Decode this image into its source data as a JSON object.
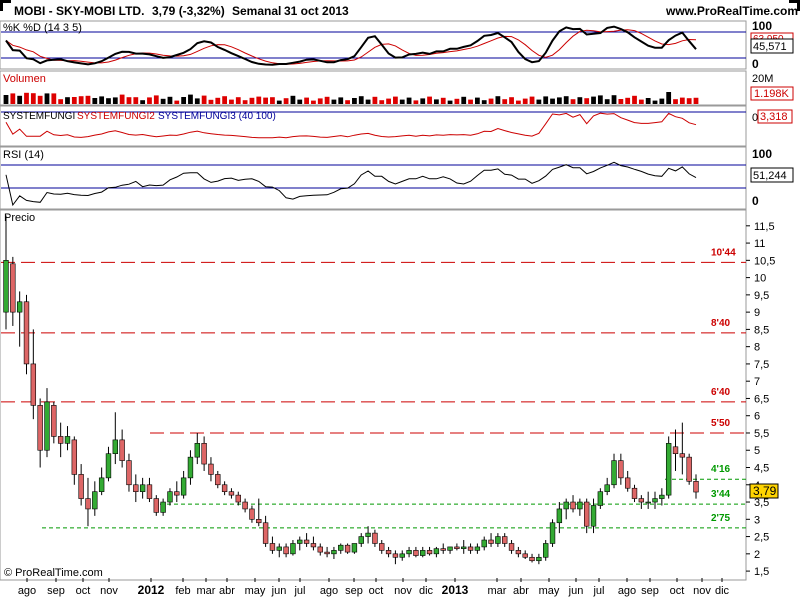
{
  "header": {
    "ticker": "MOBI - SKY-MOBI LTD.",
    "price_change": "3,79 (-3,32%)",
    "period": "Semanal",
    "date": "31 oct 2013",
    "site": "www.ProRealTime.com"
  },
  "footer": {
    "copyright": "© ProRealTime.com"
  },
  "colors": {
    "bull_candle": "#33aa33",
    "bear_candle": "#dd6666",
    "resistance": "#cc0000",
    "support": "#009900",
    "stoch_k": "#000000",
    "stoch_d": "#cc0000",
    "rsi": "#000000",
    "blue_line": "#000099",
    "volume_up": "#000000",
    "volume_down": "#dd0000"
  },
  "panels": {
    "stochastic": {
      "label": "%K %D (14 3 5)",
      "scale_top": "100",
      "scale_bottom": "0",
      "value_d": "63,950",
      "value_k": "45,571"
    },
    "volume": {
      "label": "Volumen",
      "scale_top": "20M",
      "value": "1.198K"
    },
    "systemfungi": {
      "label1": "SYSTEMFUNGI",
      "label2": "SYSTEMFUNGI2",
      "label3": "SYSTEMFUNGI3 (40 100)",
      "value": "3,318",
      "scale_left": "0"
    },
    "rsi": {
      "label": "RSI (14)",
      "scale_top": "100",
      "scale_bottom": "0",
      "value": "51,244"
    },
    "price": {
      "label": "Precio",
      "current_price": "3,79"
    }
  },
  "chart_data": {
    "type": "candlestick",
    "title": "MOBI - SKY-MOBI LTD. Semanal",
    "ylabel": "Precio",
    "ylim": [
      1.3,
      11.9
    ],
    "y_ticks": [
      "1,5",
      "2",
      "2,5",
      "3",
      "3,5",
      "4",
      "4,5",
      "5",
      "5,5",
      "6",
      "6,5",
      "7",
      "7,5",
      "8",
      "8,5",
      "9",
      "9,5",
      "10",
      "10,5",
      "11",
      "11,5"
    ],
    "x_ticks": [
      "ago",
      "sep",
      "oct",
      "nov",
      "2012",
      "feb",
      "mar",
      "abr",
      "may",
      "jun",
      "jul",
      "ago",
      "sep",
      "oct",
      "nov",
      "dic",
      "2013",
      "mar",
      "abr",
      "may",
      "jun",
      "jul",
      "ago",
      "sep",
      "oct",
      "nov",
      "dic"
    ],
    "horizontal_levels": [
      {
        "label": "10'44",
        "value": 10.44,
        "kind": "resistance"
      },
      {
        "label": "8'40",
        "value": 8.4,
        "kind": "resistance"
      },
      {
        "label": "6'40",
        "value": 6.4,
        "kind": "resistance"
      },
      {
        "label": "5'50",
        "value": 5.5,
        "kind": "resistance"
      },
      {
        "label": "4'16",
        "value": 4.16,
        "kind": "support"
      },
      {
        "label": "3'44",
        "value": 3.44,
        "kind": "support"
      },
      {
        "label": "2'75",
        "value": 2.75,
        "kind": "support"
      }
    ],
    "candles": [
      {
        "o": 9.0,
        "h": 11.8,
        "l": 8.5,
        "c": 10.5
      },
      {
        "o": 10.4,
        "h": 10.6,
        "l": 8.6,
        "c": 9.0
      },
      {
        "o": 9.0,
        "h": 9.6,
        "l": 8.0,
        "c": 9.3
      },
      {
        "o": 9.3,
        "h": 9.5,
        "l": 7.2,
        "c": 7.5
      },
      {
        "o": 7.5,
        "h": 8.5,
        "l": 5.9,
        "c": 6.3
      },
      {
        "o": 6.3,
        "h": 6.5,
        "l": 4.5,
        "c": 5.0
      },
      {
        "o": 5.0,
        "h": 6.8,
        "l": 4.8,
        "c": 6.4
      },
      {
        "o": 6.3,
        "h": 6.4,
        "l": 5.2,
        "c": 5.4
      },
      {
        "o": 5.4,
        "h": 5.8,
        "l": 4.8,
        "c": 5.2
      },
      {
        "o": 5.2,
        "h": 5.7,
        "l": 5.0,
        "c": 5.4
      },
      {
        "o": 5.3,
        "h": 5.4,
        "l": 4.0,
        "c": 4.3
      },
      {
        "o": 4.3,
        "h": 4.6,
        "l": 3.4,
        "c": 3.6
      },
      {
        "o": 3.6,
        "h": 4.2,
        "l": 2.8,
        "c": 3.3
      },
      {
        "o": 3.3,
        "h": 4.1,
        "l": 3.1,
        "c": 3.8
      },
      {
        "o": 3.8,
        "h": 4.5,
        "l": 3.7,
        "c": 4.2
      },
      {
        "o": 4.2,
        "h": 5.1,
        "l": 4.1,
        "c": 4.9
      },
      {
        "o": 4.9,
        "h": 6.1,
        "l": 4.6,
        "c": 5.3
      },
      {
        "o": 5.3,
        "h": 5.6,
        "l": 4.5,
        "c": 4.7
      },
      {
        "o": 4.7,
        "h": 4.9,
        "l": 3.8,
        "c": 4.0
      },
      {
        "o": 4.0,
        "h": 4.3,
        "l": 3.5,
        "c": 3.8
      },
      {
        "o": 3.8,
        "h": 4.2,
        "l": 3.6,
        "c": 4.0
      },
      {
        "o": 4.0,
        "h": 4.2,
        "l": 3.5,
        "c": 3.6
      },
      {
        "o": 3.6,
        "h": 3.7,
        "l": 3.1,
        "c": 3.2
      },
      {
        "o": 3.2,
        "h": 3.6,
        "l": 3.1,
        "c": 3.5
      },
      {
        "o": 3.5,
        "h": 3.9,
        "l": 3.4,
        "c": 3.8
      },
      {
        "o": 3.8,
        "h": 4.1,
        "l": 3.5,
        "c": 3.7
      },
      {
        "o": 3.7,
        "h": 4.4,
        "l": 3.6,
        "c": 4.2
      },
      {
        "o": 4.2,
        "h": 5.0,
        "l": 4.0,
        "c": 4.8
      },
      {
        "o": 4.8,
        "h": 5.5,
        "l": 4.6,
        "c": 5.2
      },
      {
        "o": 5.2,
        "h": 5.4,
        "l": 4.4,
        "c": 4.6
      },
      {
        "o": 4.6,
        "h": 4.8,
        "l": 4.1,
        "c": 4.3
      },
      {
        "o": 4.3,
        "h": 4.4,
        "l": 3.9,
        "c": 4.0
      },
      {
        "o": 4.0,
        "h": 4.1,
        "l": 3.7,
        "c": 3.8
      },
      {
        "o": 3.8,
        "h": 3.9,
        "l": 3.6,
        "c": 3.7
      },
      {
        "o": 3.7,
        "h": 3.8,
        "l": 3.4,
        "c": 3.5
      },
      {
        "o": 3.5,
        "h": 3.6,
        "l": 3.2,
        "c": 3.3
      },
      {
        "o": 3.3,
        "h": 3.4,
        "l": 2.9,
        "c": 3.0
      },
      {
        "o": 3.0,
        "h": 3.6,
        "l": 2.8,
        "c": 2.9
      },
      {
        "o": 2.9,
        "h": 3.1,
        "l": 2.2,
        "c": 2.3
      },
      {
        "o": 2.3,
        "h": 2.5,
        "l": 2.0,
        "c": 2.1
      },
      {
        "o": 2.1,
        "h": 2.3,
        "l": 1.9,
        "c": 2.2
      },
      {
        "o": 2.2,
        "h": 2.3,
        "l": 1.9,
        "c": 2.0
      },
      {
        "o": 2.0,
        "h": 2.4,
        "l": 1.95,
        "c": 2.3
      },
      {
        "o": 2.3,
        "h": 2.5,
        "l": 2.1,
        "c": 2.4
      },
      {
        "o": 2.4,
        "h": 2.6,
        "l": 2.2,
        "c": 2.3
      },
      {
        "o": 2.3,
        "h": 2.5,
        "l": 2.1,
        "c": 2.2
      },
      {
        "o": 2.2,
        "h": 2.3,
        "l": 1.95,
        "c": 2.05
      },
      {
        "o": 2.05,
        "h": 2.2,
        "l": 1.9,
        "c": 2.0
      },
      {
        "o": 2.0,
        "h": 2.2,
        "l": 1.85,
        "c": 2.1
      },
      {
        "o": 2.1,
        "h": 2.3,
        "l": 2.0,
        "c": 2.25
      },
      {
        "o": 2.25,
        "h": 2.3,
        "l": 2.0,
        "c": 2.05
      },
      {
        "o": 2.05,
        "h": 2.3,
        "l": 2.0,
        "c": 2.3
      },
      {
        "o": 2.3,
        "h": 2.6,
        "l": 2.2,
        "c": 2.5
      },
      {
        "o": 2.5,
        "h": 2.8,
        "l": 2.3,
        "c": 2.6
      },
      {
        "o": 2.6,
        "h": 2.7,
        "l": 2.2,
        "c": 2.3
      },
      {
        "o": 2.3,
        "h": 2.4,
        "l": 2.0,
        "c": 2.1
      },
      {
        "o": 2.1,
        "h": 2.2,
        "l": 1.9,
        "c": 2.0
      },
      {
        "o": 2.0,
        "h": 2.1,
        "l": 1.7,
        "c": 1.9
      },
      {
        "o": 1.9,
        "h": 2.1,
        "l": 1.8,
        "c": 2.0
      },
      {
        "o": 2.0,
        "h": 2.2,
        "l": 1.9,
        "c": 2.1
      },
      {
        "o": 2.1,
        "h": 2.2,
        "l": 1.9,
        "c": 1.95
      },
      {
        "o": 1.95,
        "h": 2.2,
        "l": 1.9,
        "c": 2.1
      },
      {
        "o": 2.1,
        "h": 2.2,
        "l": 1.95,
        "c": 2.0
      },
      {
        "o": 2.0,
        "h": 2.2,
        "l": 1.9,
        "c": 2.15
      },
      {
        "o": 2.15,
        "h": 2.3,
        "l": 2.0,
        "c": 2.1
      },
      {
        "o": 2.1,
        "h": 2.2,
        "l": 2.0,
        "c": 2.2
      },
      {
        "o": 2.2,
        "h": 2.3,
        "l": 2.1,
        "c": 2.15
      },
      {
        "o": 2.15,
        "h": 2.4,
        "l": 2.0,
        "c": 2.2
      },
      {
        "o": 2.2,
        "h": 2.3,
        "l": 2.0,
        "c": 2.1
      },
      {
        "o": 2.1,
        "h": 2.3,
        "l": 2.0,
        "c": 2.2
      },
      {
        "o": 2.2,
        "h": 2.5,
        "l": 2.1,
        "c": 2.4
      },
      {
        "o": 2.4,
        "h": 2.6,
        "l": 2.2,
        "c": 2.3
      },
      {
        "o": 2.3,
        "h": 2.6,
        "l": 2.2,
        "c": 2.5
      },
      {
        "o": 2.5,
        "h": 2.6,
        "l": 2.2,
        "c": 2.3
      },
      {
        "o": 2.3,
        "h": 2.4,
        "l": 2.0,
        "c": 2.1
      },
      {
        "o": 2.1,
        "h": 2.2,
        "l": 1.9,
        "c": 2.0
      },
      {
        "o": 2.0,
        "h": 2.1,
        "l": 1.85,
        "c": 1.9
      },
      {
        "o": 1.9,
        "h": 2.0,
        "l": 1.75,
        "c": 1.8
      },
      {
        "o": 1.8,
        "h": 2.0,
        "l": 1.7,
        "c": 1.9
      },
      {
        "o": 1.9,
        "h": 2.4,
        "l": 1.8,
        "c": 2.3
      },
      {
        "o": 2.3,
        "h": 3.0,
        "l": 2.2,
        "c": 2.9
      },
      {
        "o": 2.9,
        "h": 3.5,
        "l": 2.6,
        "c": 3.3
      },
      {
        "o": 3.3,
        "h": 3.6,
        "l": 3.0,
        "c": 3.5
      },
      {
        "o": 3.5,
        "h": 3.7,
        "l": 3.2,
        "c": 3.3
      },
      {
        "o": 3.3,
        "h": 3.6,
        "l": 3.1,
        "c": 3.5
      },
      {
        "o": 3.5,
        "h": 3.6,
        "l": 2.6,
        "c": 2.8
      },
      {
        "o": 2.8,
        "h": 3.6,
        "l": 2.6,
        "c": 3.4
      },
      {
        "o": 3.4,
        "h": 3.9,
        "l": 3.3,
        "c": 3.8
      },
      {
        "o": 3.8,
        "h": 4.2,
        "l": 3.7,
        "c": 4.0
      },
      {
        "o": 4.0,
        "h": 4.9,
        "l": 3.9,
        "c": 4.7
      },
      {
        "o": 4.7,
        "h": 4.9,
        "l": 4.0,
        "c": 4.2
      },
      {
        "o": 4.2,
        "h": 4.4,
        "l": 3.8,
        "c": 3.9
      },
      {
        "o": 3.9,
        "h": 4.0,
        "l": 3.5,
        "c": 3.6
      },
      {
        "o": 3.6,
        "h": 3.7,
        "l": 3.3,
        "c": 3.5
      },
      {
        "o": 3.5,
        "h": 3.8,
        "l": 3.3,
        "c": 3.5
      },
      {
        "o": 3.5,
        "h": 3.8,
        "l": 3.3,
        "c": 3.6
      },
      {
        "o": 3.6,
        "h": 3.9,
        "l": 3.4,
        "c": 3.7
      },
      {
        "o": 3.7,
        "h": 5.4,
        "l": 3.6,
        "c": 5.2
      },
      {
        "o": 5.1,
        "h": 5.6,
        "l": 4.4,
        "c": 4.9
      },
      {
        "o": 4.9,
        "h": 5.8,
        "l": 4.3,
        "c": 4.8
      },
      {
        "o": 4.8,
        "h": 4.9,
        "l": 4.0,
        "c": 4.1
      },
      {
        "o": 4.1,
        "h": 4.3,
        "l": 3.6,
        "c": 3.79
      }
    ]
  }
}
